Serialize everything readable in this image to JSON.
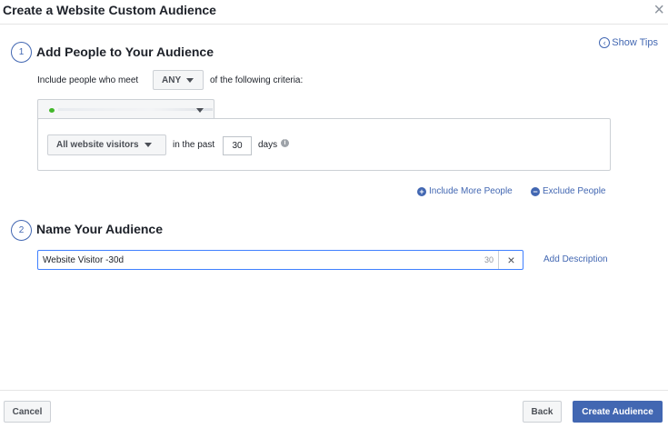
{
  "dialog": {
    "title": "Create a Website Custom Audience"
  },
  "show_tips": "Show Tips",
  "step1": {
    "number": "1",
    "title": "Add People to Your Audience",
    "include_prefix": "Include people who meet",
    "match_value": "ANY",
    "include_suffix": "of the following criteria:",
    "rule": {
      "visitors_option": "All website visitors",
      "in_the_past": "in the past",
      "days_value": "30",
      "days_label": "days"
    },
    "include_more": "Include More People",
    "exclude": "Exclude People"
  },
  "step2": {
    "number": "2",
    "title": "Name Your Audience",
    "name_value": "Website Visitor -30d",
    "char_count": "30",
    "add_description": "Add Description"
  },
  "footer": {
    "cancel": "Cancel",
    "back": "Back",
    "create": "Create Audience"
  },
  "colors": {
    "accent": "#4267b2",
    "focus_border": "#4080ff",
    "pixel_dot": "#42b72a"
  }
}
